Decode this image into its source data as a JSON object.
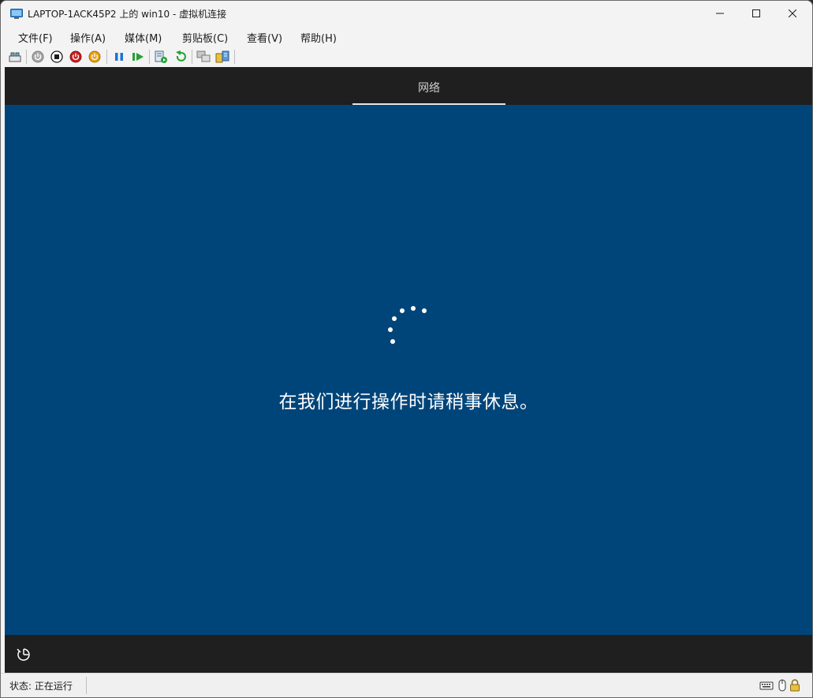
{
  "window": {
    "title": "LAPTOP-1ACK45P2 上的 win10 - 虚拟机连接"
  },
  "menubar": {
    "items": [
      {
        "label": "文件(F)"
      },
      {
        "label": "操作(A)"
      },
      {
        "label": "媒体(M)"
      },
      {
        "label": "剪贴板(C)"
      },
      {
        "label": "查看(V)"
      },
      {
        "label": "帮助(H)"
      }
    ]
  },
  "toolbar": {
    "icons": [
      "ctrl-alt-del-icon",
      "start-icon",
      "turn-off-icon",
      "shut-down-icon",
      "power-save-icon",
      "pause-icon",
      "resume-icon",
      "checkpoint-icon",
      "revert-icon",
      "enhanced-session-icon",
      "share-icon"
    ]
  },
  "vm": {
    "tab_label": "网络",
    "waiting_text": "在我们进行操作时请稍事休息。",
    "colors": {
      "background": "#00457a",
      "header": "#1f1f1f"
    }
  },
  "statusbar": {
    "status_text": "状态: 正在运行",
    "icons": [
      "keyboard-icon",
      "mouse-icon",
      "lock-icon"
    ]
  }
}
